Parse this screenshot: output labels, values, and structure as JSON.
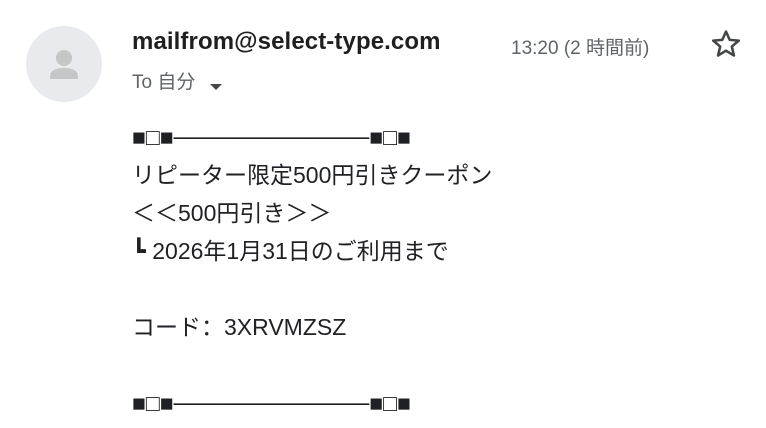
{
  "message": {
    "sender": "mailfrom@select-type.com",
    "time": "13:20 (2 時間前)",
    "recipient_label": "To 自分",
    "icons": {
      "avatar": "person-icon",
      "star": "star-outline-icon",
      "caret": "caret-down-icon"
    }
  },
  "body": {
    "divider_top": "■□■────────────■□■",
    "line1": "リピーター限定500円引きクーポン",
    "line2": "＜＜500円引き＞＞",
    "line3": "┗ 2026年1月31日のご利用まで",
    "code_line": "コード：3XRVMZSZ",
    "divider_bottom": "■□■────────────■□■"
  },
  "colors": {
    "avatar_bg": "#e8eaed",
    "avatar_fg": "#c4c7c5",
    "secondary_text": "#5f6368"
  }
}
